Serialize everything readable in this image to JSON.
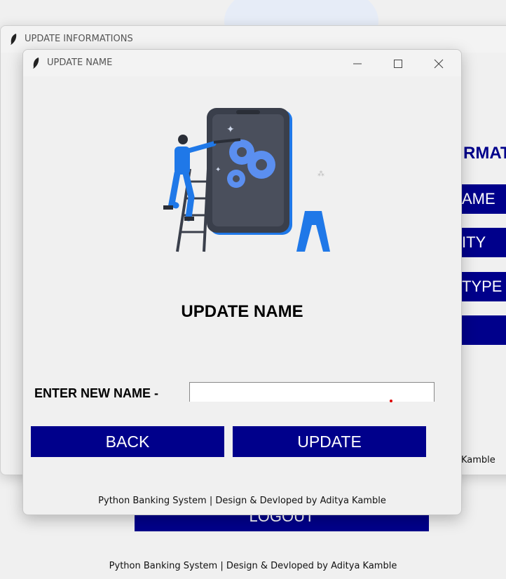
{
  "background_window": {
    "logout_label": "LOGOUT",
    "footer": "Python Banking System | Design & Devloped by Aditya Kamble"
  },
  "update_info_window": {
    "title": "UPDATE INFORMATIONS",
    "heading_fragment": "RMAT",
    "buttons": [
      "AME",
      "ITY",
      "TYPE",
      ""
    ],
    "credit_fragment": "Kamble"
  },
  "update_name_window": {
    "title": "UPDATE NAME",
    "controls": {
      "minimize": "minimize",
      "maximize": "maximize",
      "close": "close"
    },
    "heading": "UPDATE NAME",
    "name_label": "ENTER NEW NAME -",
    "name_input": {
      "value": "",
      "placeholder": ""
    },
    "back_label": "BACK",
    "update_label": "UPDATE",
    "credit": "Python Banking System | Design & Devloped by Aditya Kamble"
  },
  "colors": {
    "accent": "#00008b",
    "window_bg": "#f0f0f0"
  }
}
